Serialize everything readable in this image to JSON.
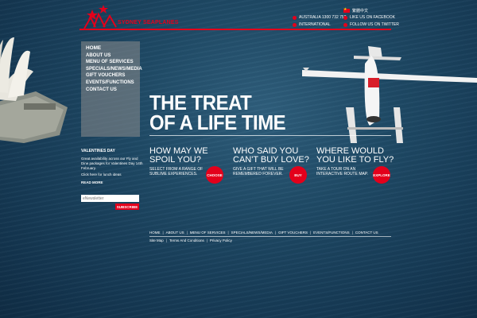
{
  "brand": {
    "name": "SYDNEY SEAPLANES",
    "accent": "#e3001b"
  },
  "header": {
    "chinese": "繁體中文",
    "phone": "AUSTRALIA 1300 732 752",
    "international": "INTERNATIONAL",
    "facebook": "LIKE US ON FACEBOOK",
    "twitter": "FOLLOW US ON TWITTER"
  },
  "nav": {
    "items": [
      "HOME",
      "ABOUT US",
      "MENU OF SERVICES",
      "SPECIALS/NEWS/MEDIA",
      "GIFT VOUCHERS",
      "EVENTS/FUNCTIONS",
      "CONTACT US"
    ]
  },
  "hero": {
    "line1": "THE TREAT",
    "line2": "OF A LIFE TIME"
  },
  "promos": [
    {
      "title1": "HOW MAY WE",
      "title2": "SPOIL YOU?",
      "desc": "SELECT FROM A RANGE OF SUBLIME EXPERIENCES.",
      "button": "CHOOSE"
    },
    {
      "title1": "WHO SAID YOU",
      "title2": "CAN'T BUY LOVE?",
      "desc": "GIVE A GIFT THAT WILL BE REMEMBERED FOREVER.",
      "button": "BUY"
    },
    {
      "title1": "WHERE WOULD",
      "title2": "YOU LIKE TO FLY?",
      "desc": "TAKE A TOUR ON AN INTERACTIVE ROUTE MAP.",
      "button": "EXPLORE"
    }
  ],
  "news": {
    "heading": "VALENTINES DAY",
    "body": "Great availability across our Fly and Dine packages for Valentines Day 14th February.",
    "link": "Click here for lunch ideas",
    "read_more": "READ MORE"
  },
  "newsletter": {
    "placeholder": "eNewsletter",
    "button": "SUBSCRIBE"
  },
  "footer": {
    "nav": [
      "HOME",
      "ABOUT US",
      "MENU OF SERVICES",
      "SPECIALS/NEWS/MEDIA",
      "GIFT VOUCHERS",
      "EVENTS/FUNCTIONS",
      "CONTACT US"
    ],
    "sub": [
      "Site Map",
      "Terms And Conditions",
      "Privacy Policy"
    ]
  }
}
